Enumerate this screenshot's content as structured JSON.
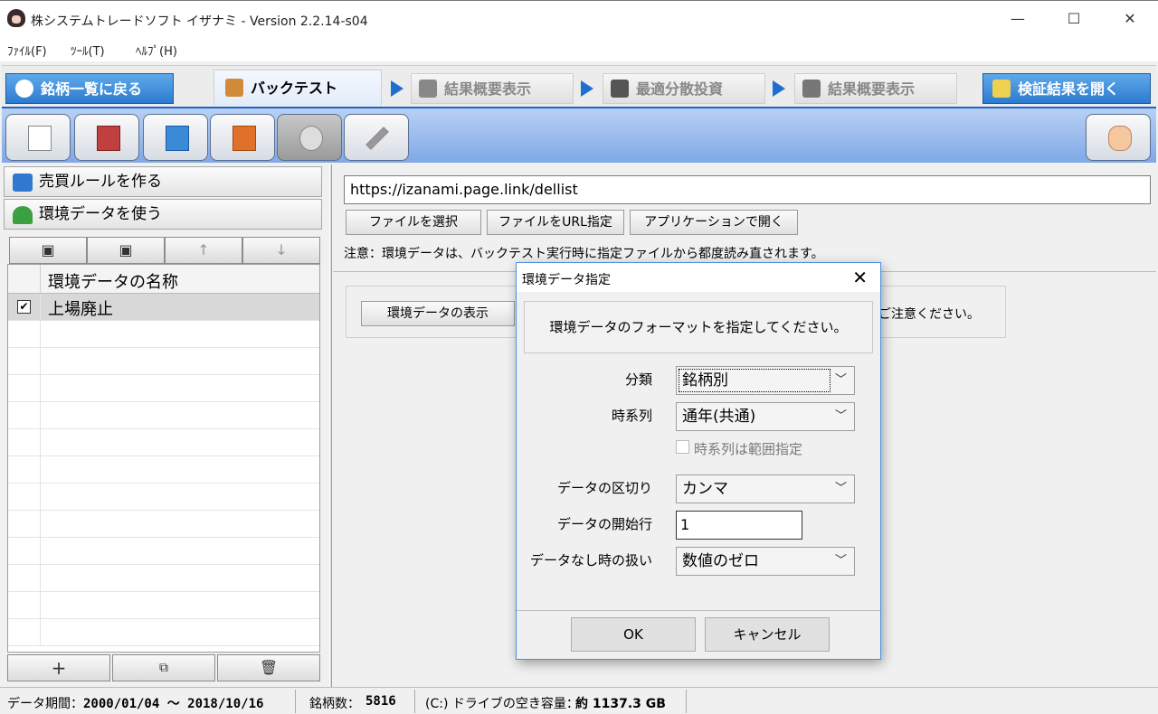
{
  "window": {
    "title": "株システムトレードソフト イザナミ - Version 2.2.14-s04",
    "minimize": "—",
    "maximize": "☐",
    "close": "✕"
  },
  "menu": [
    "ﾌｧｲﾙ(F)",
    "ﾂｰﾙ(T)",
    "ﾍﾙﾌﾟ(H)"
  ],
  "tabs": {
    "back_to_list": "銘柄一覧に戻る",
    "backtest": "バックテスト",
    "summary1": "結果概要表示",
    "optimal": "最適分散投資",
    "summary2": "結果概要表示",
    "open_results": "検証結果を開く"
  },
  "left_panel": {
    "make_rules": "売買ルールを作る",
    "use_env_data": "環境データを使う",
    "up_arrow": "↑",
    "down_arrow": "↓",
    "list_header": "環境データの名称",
    "items": [
      {
        "checked": "✔",
        "name": "上場廃止"
      }
    ],
    "add": "+",
    "delete": "🗑"
  },
  "right_panel": {
    "url": "https://izanami.page.link/dellist",
    "buttons": {
      "select_file": "ファイルを選択",
      "url_specify": "ファイルをURL指定",
      "open_app": "アプリケーションで開く"
    },
    "note": "注意：環境データは、バックテスト実行時に指定ファイルから都度読み直されます。",
    "show_env_data": "環境データの表示",
    "partial_note": "ご注意ください。"
  },
  "dialog": {
    "title": "環境データ指定",
    "close": "✕",
    "instruction": "環境データのフォーマットを指定してください。",
    "fields": {
      "category_label": "分類",
      "category_value": "銘柄別",
      "timeseries_label": "時系列",
      "timeseries_value": "通年(共通)",
      "range_checkbox": "時系列は範囲指定",
      "delimiter_label": "データの区切り",
      "delimiter_value": "カンマ",
      "start_row_label": "データの開始行",
      "start_row_value": "1",
      "nodata_label": "データなし時の扱い",
      "nodata_value": "数値のゼロ"
    },
    "ok": "OK",
    "cancel": "キャンセル"
  },
  "status": {
    "period_label": "データ期間：",
    "period_value": "2000/01/04 ～ 2018/10/16",
    "count_label": "銘柄数：",
    "count_value": "5816",
    "disk_label": "(C:) ドライブの空き容量：",
    "disk_value": "約 1137.3 GB"
  }
}
